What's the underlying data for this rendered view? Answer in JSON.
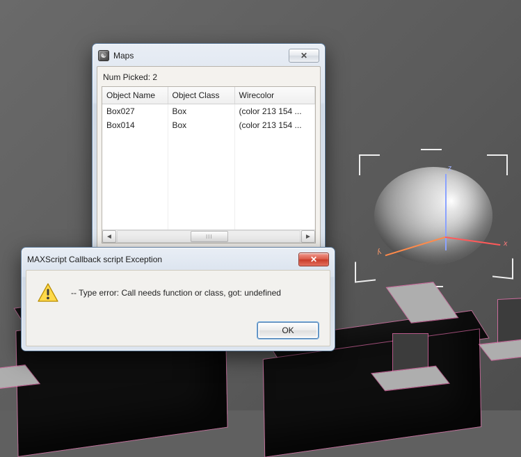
{
  "maps_window": {
    "title": "Maps",
    "num_picked_label": "Num Picked: 2",
    "columns": {
      "object_name": "Object Name",
      "object_class": "Object Class",
      "wirecolor": "Wirecolor"
    },
    "rows": [
      {
        "object_name": "Box027",
        "object_class": "Box",
        "wirecolor": "(color 213 154 ..."
      },
      {
        "object_name": "Box014",
        "object_class": "Box",
        "wirecolor": "(color 213 154 ..."
      }
    ]
  },
  "error_window": {
    "title": "MAXScript Callback script Exception",
    "message": "-- Type error: Call needs function or class, got: undefined",
    "ok_label": "OK"
  },
  "icons": {
    "app": "⌘",
    "close": "✕",
    "scroll_thumb": "III",
    "arrow_left": "◄",
    "arrow_right": "►"
  }
}
